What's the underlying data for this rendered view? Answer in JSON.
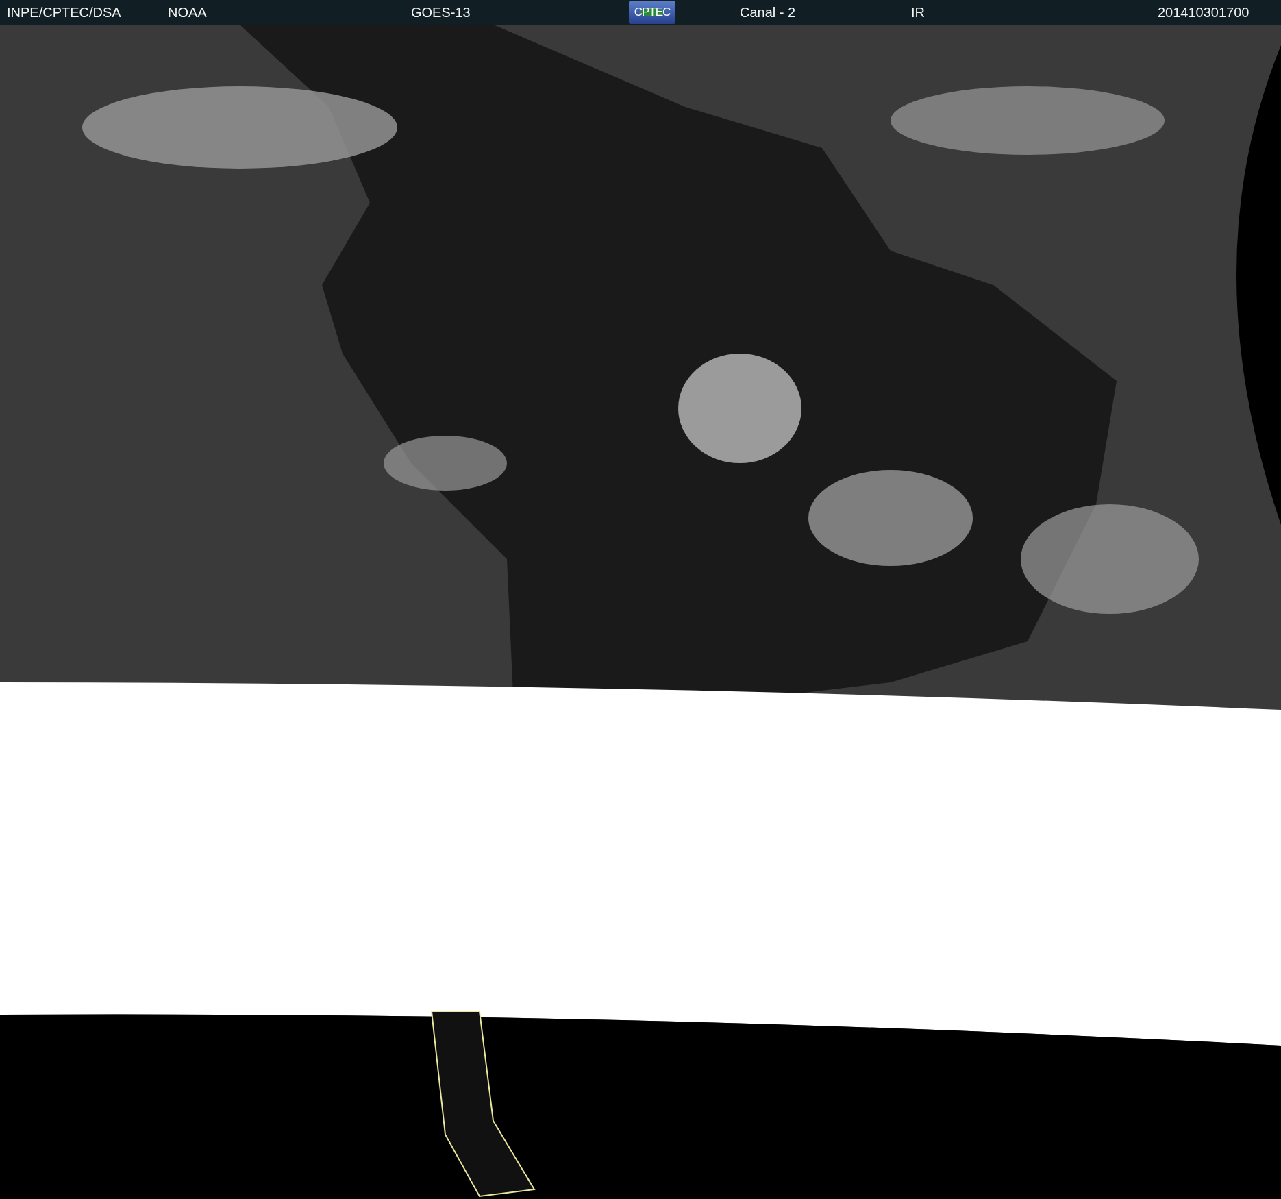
{
  "header": {
    "items": [
      {
        "kind": "text",
        "text": "INPE/CPTEC/DSA"
      },
      {
        "kind": "text",
        "text": "NOAA"
      },
      {
        "kind": "text",
        "text": "GOES-13"
      },
      {
        "kind": "logo",
        "text": "CPTEC"
      },
      {
        "kind": "text",
        "text": "Canal - 2"
      },
      {
        "kind": "text",
        "text": "IR"
      },
      {
        "kind": "text",
        "text": "201410301700"
      }
    ]
  }
}
